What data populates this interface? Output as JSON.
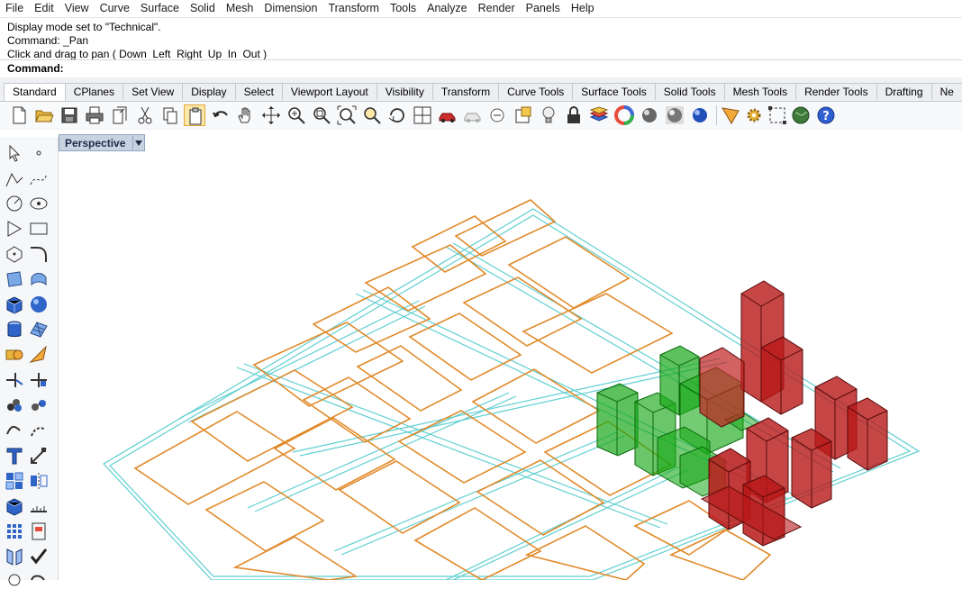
{
  "menubar": {
    "items": [
      "File",
      "Edit",
      "View",
      "Curve",
      "Surface",
      "Solid",
      "Mesh",
      "Dimension",
      "Transform",
      "Tools",
      "Analyze",
      "Render",
      "Panels",
      "Help"
    ]
  },
  "command": {
    "history": [
      "Display mode set to \"Technical\".",
      "Command: _Pan",
      "Click and drag to pan ( Down  Left  Right  Up  In  Out )"
    ],
    "prompt": "Command:"
  },
  "toolbar": {
    "tabs": [
      "Standard",
      "CPlanes",
      "Set View",
      "Display",
      "Select",
      "Viewport Layout",
      "Visibility",
      "Transform",
      "Curve Tools",
      "Surface Tools",
      "Solid Tools",
      "Mesh Tools",
      "Render Tools",
      "Drafting",
      "Ne"
    ],
    "active_tab": "Standard",
    "icons": [
      "new-file-icon",
      "open-folder-icon",
      "save-icon",
      "print-icon",
      "import-icon",
      "cut-icon",
      "copy-icon",
      "paste-icon",
      "undo-icon",
      "pan-hand-icon",
      "move-view-icon",
      "zoom-in-icon",
      "zoom-window-icon",
      "zoom-extents-icon",
      "zoom-selected-icon",
      "rotate-view-icon",
      "four-viewports-icon",
      "car-render-icon",
      "ghost-view-icon",
      "cplane-icon",
      "snap-icon",
      "light-bulb-icon",
      "lock-icon",
      "layer-icon",
      "color-wheel-icon",
      "material-sphere-icon",
      "render-sphere-icon",
      "blue-sphere-icon",
      "dimension-icon",
      "options-gear-icon",
      "selection-icon",
      "earth-icon",
      "help-icon"
    ]
  },
  "left_toolbar": {
    "icons": [
      "select-arrow-icon",
      "point-icon",
      "polyline-icon",
      "curve-point-icon",
      "circle-icon",
      "ellipse-icon",
      "arc-icon",
      "rectangle-icon",
      "polygon-icon",
      "fillet-icon",
      "surface-corner-icon",
      "surface-loft-icon",
      "box-icon",
      "sphere-icon",
      "cylinder-icon",
      "mesh-icon",
      "boolean-icon",
      "explode-icon",
      "trim-icon",
      "split-icon",
      "group-icon",
      "join-icon",
      "offset-icon",
      "extend-icon",
      "text-icon",
      "dimension-icon",
      "array-icon",
      "mirror-icon",
      "solid-box-icon",
      "ruler-icon",
      "grid-icon",
      "bounding-icon",
      "book-icon",
      "check-icon"
    ]
  },
  "viewport": {
    "title": "Perspective"
  },
  "colors": {
    "road_lines": "#5fcfd1",
    "block_outline": "#e08a2a",
    "green_buildings": "#18a818",
    "red_buildings": "#b81818",
    "toolbar_bg": "#eef0f3",
    "viewport_tab": "#c8d3e2"
  }
}
